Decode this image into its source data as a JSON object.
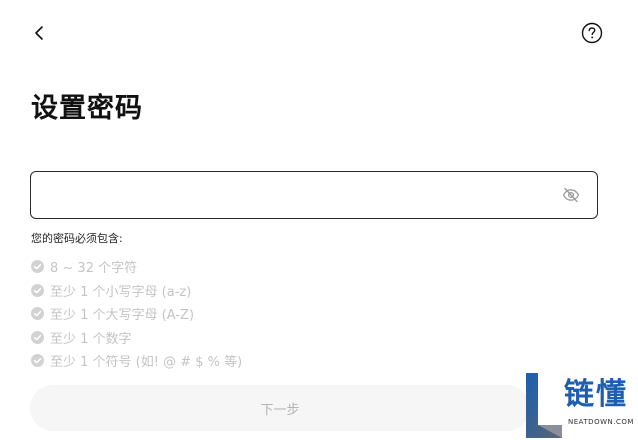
{
  "header": {
    "back_icon": "chevron-left-icon",
    "help_icon": "question-circle-icon"
  },
  "title": "设置密码",
  "password_field": {
    "value": "",
    "placeholder": "",
    "visibility_icon": "eye-off-icon"
  },
  "requirements": {
    "heading": "您的密码必须包含:",
    "items": [
      "8 ~ 32 个字符",
      "至少 1 个小写字母 (a-z)",
      "至少 1 个大写字母 (A-Z)",
      "至少 1 个数字",
      "至少 1 个符号 (如! @ # $ % 等)"
    ],
    "check_icon": "check-circle-icon",
    "unmet_color": "#c4c4c4"
  },
  "next_button": {
    "label": "下一步",
    "enabled": false
  },
  "watermark": {
    "text": "链懂",
    "subtext": "NEATDOWN.COM",
    "color": "#1c5fb0"
  }
}
